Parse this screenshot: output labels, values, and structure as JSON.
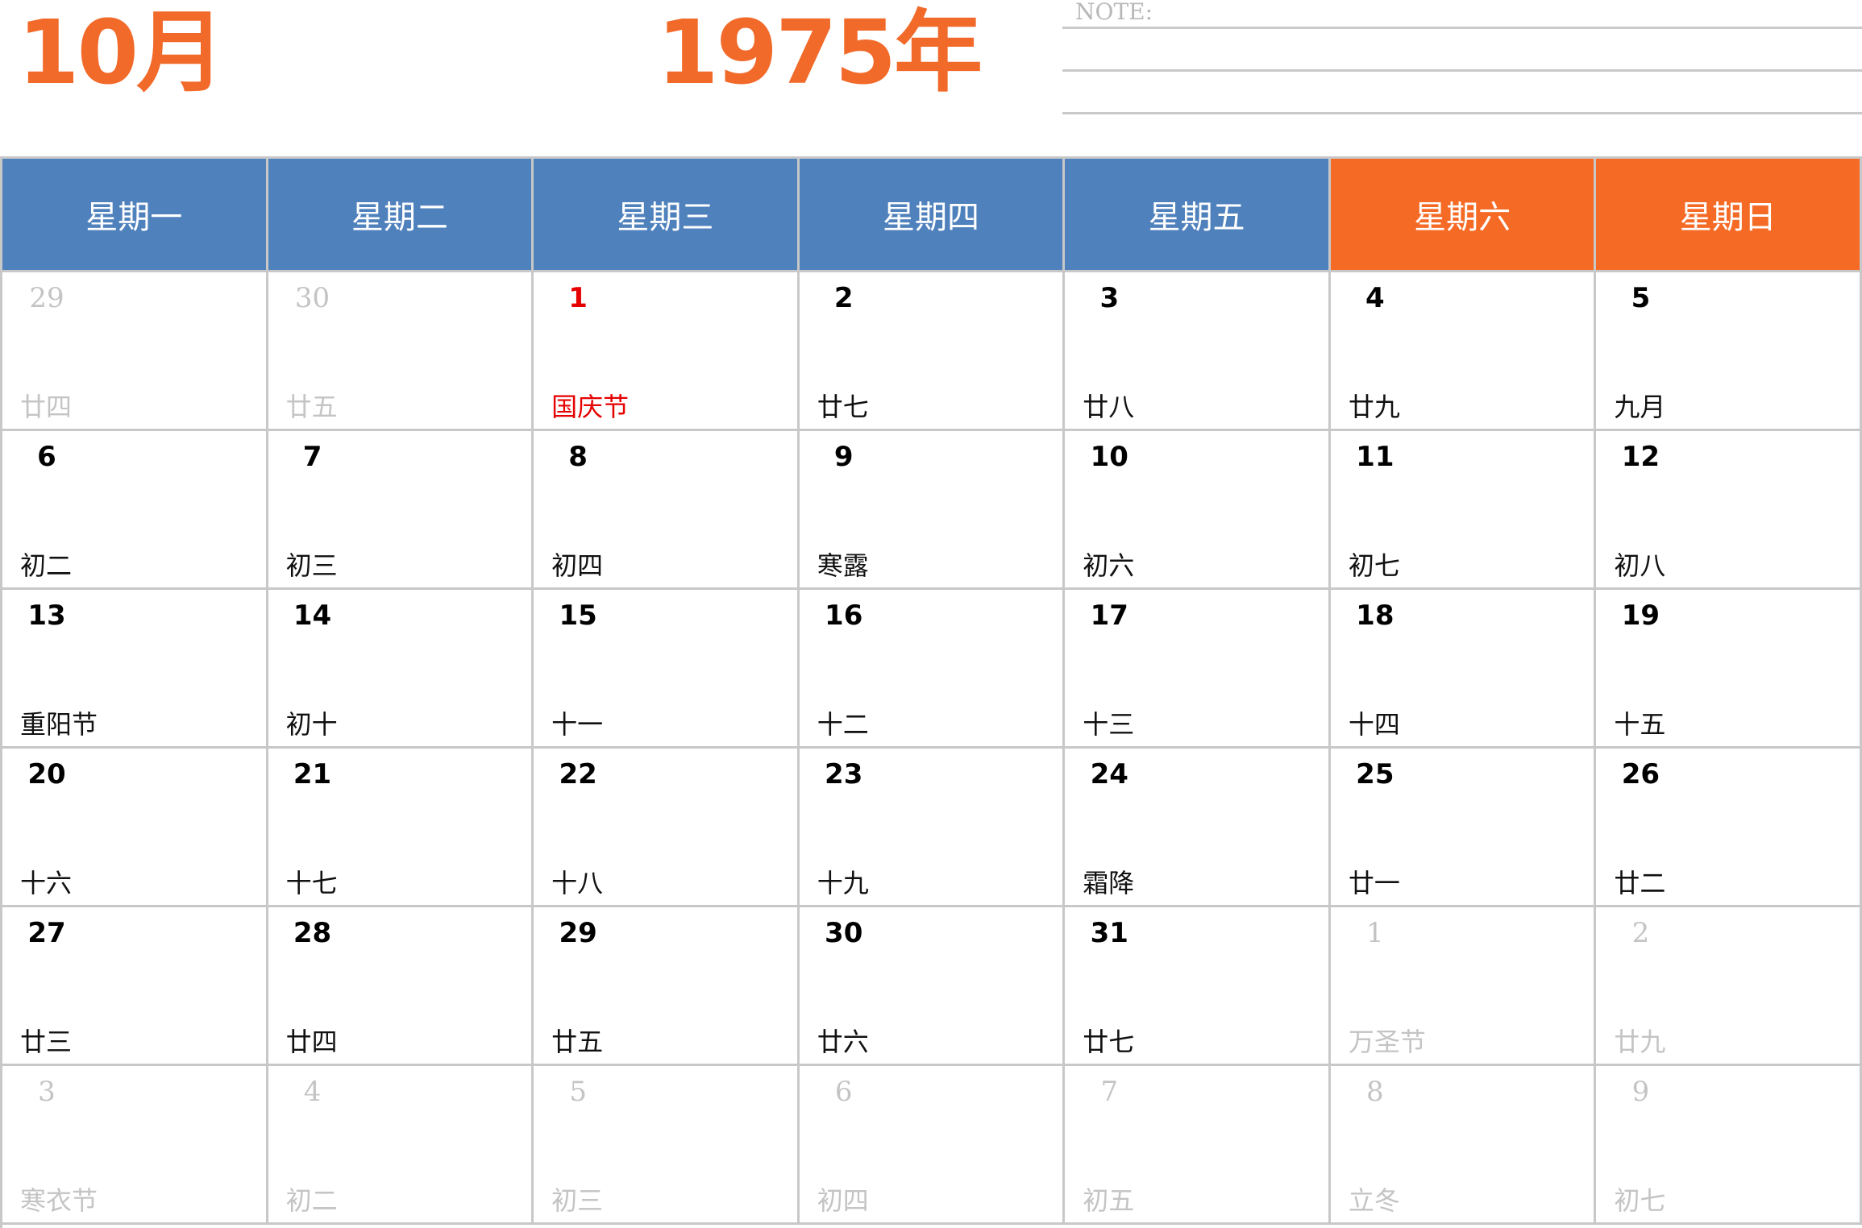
{
  "header": {
    "month": "10月",
    "year": "1975年",
    "note_label": "NOTE:"
  },
  "colors": {
    "accent": "#f16a2a",
    "weekday_header": "#4f81bd",
    "weekend_header": "#f56a25",
    "holiday": "#e60000",
    "muted": "#c4c4c4"
  },
  "weekdays": [
    {
      "label": "星期一",
      "weekend": false
    },
    {
      "label": "星期二",
      "weekend": false
    },
    {
      "label": "星期三",
      "weekend": false
    },
    {
      "label": "星期四",
      "weekend": false
    },
    {
      "label": "星期五",
      "weekend": false
    },
    {
      "label": "星期六",
      "weekend": true
    },
    {
      "label": "星期日",
      "weekend": true
    }
  ],
  "weeks": [
    [
      {
        "day": "29",
        "lunar": "廿四",
        "other": true
      },
      {
        "day": "30",
        "lunar": "廿五",
        "other": true
      },
      {
        "day": "1",
        "lunar": "国庆节",
        "holiday": true
      },
      {
        "day": "2",
        "lunar": "廿七"
      },
      {
        "day": "3",
        "lunar": "廿八"
      },
      {
        "day": "4",
        "lunar": "廿九"
      },
      {
        "day": "5",
        "lunar": "九月"
      }
    ],
    [
      {
        "day": "6",
        "lunar": "初二"
      },
      {
        "day": "7",
        "lunar": "初三"
      },
      {
        "day": "8",
        "lunar": "初四"
      },
      {
        "day": "9",
        "lunar": "寒露"
      },
      {
        "day": "10",
        "lunar": "初六"
      },
      {
        "day": "11",
        "lunar": "初七"
      },
      {
        "day": "12",
        "lunar": "初八"
      }
    ],
    [
      {
        "day": "13",
        "lunar": "重阳节"
      },
      {
        "day": "14",
        "lunar": "初十"
      },
      {
        "day": "15",
        "lunar": "十一"
      },
      {
        "day": "16",
        "lunar": "十二"
      },
      {
        "day": "17",
        "lunar": "十三"
      },
      {
        "day": "18",
        "lunar": "十四"
      },
      {
        "day": "19",
        "lunar": "十五"
      }
    ],
    [
      {
        "day": "20",
        "lunar": "十六"
      },
      {
        "day": "21",
        "lunar": "十七"
      },
      {
        "day": "22",
        "lunar": "十八"
      },
      {
        "day": "23",
        "lunar": "十九"
      },
      {
        "day": "24",
        "lunar": "霜降"
      },
      {
        "day": "25",
        "lunar": "廿一"
      },
      {
        "day": "26",
        "lunar": "廿二"
      }
    ],
    [
      {
        "day": "27",
        "lunar": "廿三"
      },
      {
        "day": "28",
        "lunar": "廿四"
      },
      {
        "day": "29",
        "lunar": "廿五"
      },
      {
        "day": "30",
        "lunar": "廿六"
      },
      {
        "day": "31",
        "lunar": "廿七"
      },
      {
        "day": "1",
        "lunar": "万圣节",
        "other": true
      },
      {
        "day": "2",
        "lunar": "廿九",
        "other": true
      }
    ],
    [
      {
        "day": "3",
        "lunar": "寒衣节",
        "other": true
      },
      {
        "day": "4",
        "lunar": "初二",
        "other": true
      },
      {
        "day": "5",
        "lunar": "初三",
        "other": true
      },
      {
        "day": "6",
        "lunar": "初四",
        "other": true
      },
      {
        "day": "7",
        "lunar": "初五",
        "other": true
      },
      {
        "day": "8",
        "lunar": "立冬",
        "other": true
      },
      {
        "day": "9",
        "lunar": "初七",
        "other": true
      }
    ]
  ]
}
